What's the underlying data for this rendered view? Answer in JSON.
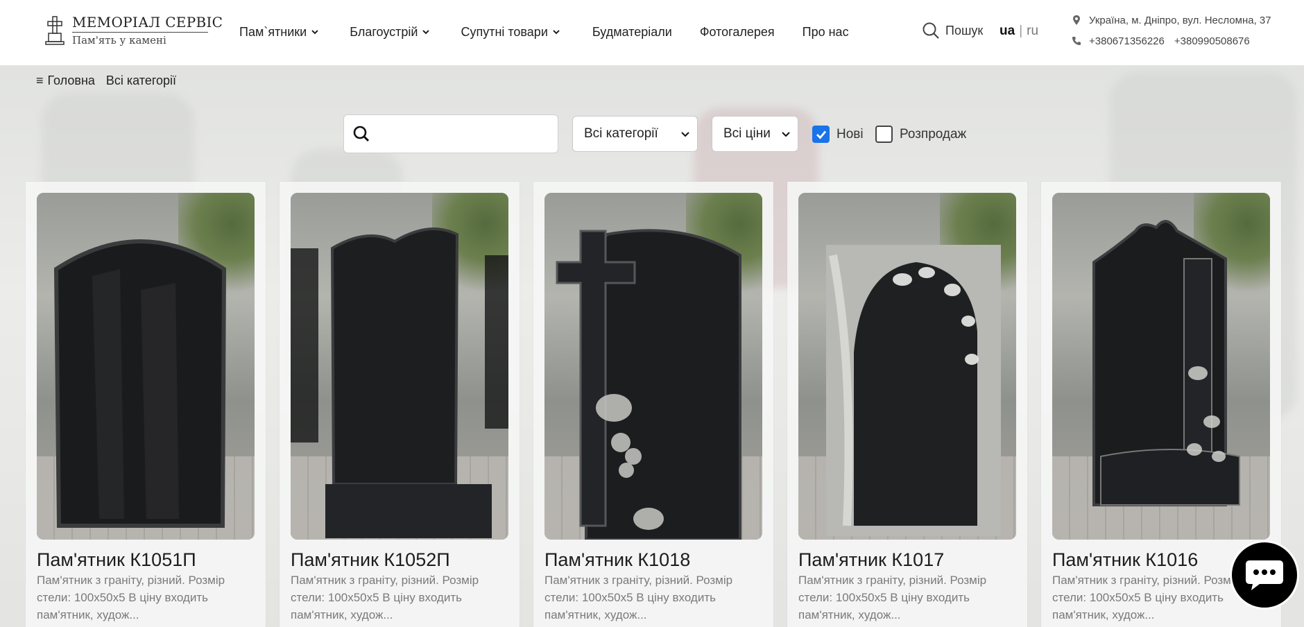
{
  "logo": {
    "title": "МЕМОРІАЛ СЕРВІС",
    "subtitle": "Пам'ять у камені",
    "icon": "tombstone-cross-icon"
  },
  "nav": {
    "items": [
      {
        "label": "Пам`ятники",
        "dropdown": true
      },
      {
        "label": "Благоустрій",
        "dropdown": true
      },
      {
        "label": "Супутні товари",
        "dropdown": true
      },
      {
        "label": "Будматеріали",
        "dropdown": false
      },
      {
        "label": "Фотогалерея",
        "dropdown": false
      },
      {
        "label": "Про нас",
        "dropdown": false
      }
    ],
    "search_label": "Пошук"
  },
  "lang": {
    "active": "ua",
    "separator": "|",
    "other": "ru"
  },
  "contacts": {
    "address": "Україна, м. Дніпро, вул. Несломна, 37",
    "phones": [
      "+380671356226",
      "+380990508676"
    ]
  },
  "breadcrumb": {
    "menu_icon": "≡",
    "home": "Головна",
    "current": "Всі категорії"
  },
  "filters": {
    "search_placeholder": "",
    "category": "Всі категорії",
    "price": "Всі ціни",
    "new_label": "Нові",
    "new_checked": true,
    "sale_label": "Розпродаж",
    "sale_checked": false,
    "accent": "#1a73e8"
  },
  "products": [
    {
      "title": "Пам'ятник К1051П",
      "desc": "Пам'ятник з граніту, різний. Розмір стели: 100х50х5 В ціну входить пам'ятник, худож..."
    },
    {
      "title": "Пам'ятник К1052П",
      "desc": "Пам'ятник з граніту, різний. Розмір стели: 100х50х5 В ціну входить пам'ятник, худож..."
    },
    {
      "title": "Пам'ятник К1018",
      "desc": "Пам'ятник з граніту, різний. Розмір стели: 100х50х5 В ціну входить пам'ятник, худож..."
    },
    {
      "title": "Пам'ятник К1017",
      "desc": "Пам'ятник з граніту, різний. Розмір стели: 100х50х5 В ціну входить пам'ятник, худож..."
    },
    {
      "title": "Пам'ятник К1016",
      "desc": "Пам'ятник з граніту, різний. Розмір стели: 100х50х5 В ціну входить пам'ятник, худож..."
    }
  ],
  "chat": {
    "icon": "chat-bubble-icon"
  }
}
